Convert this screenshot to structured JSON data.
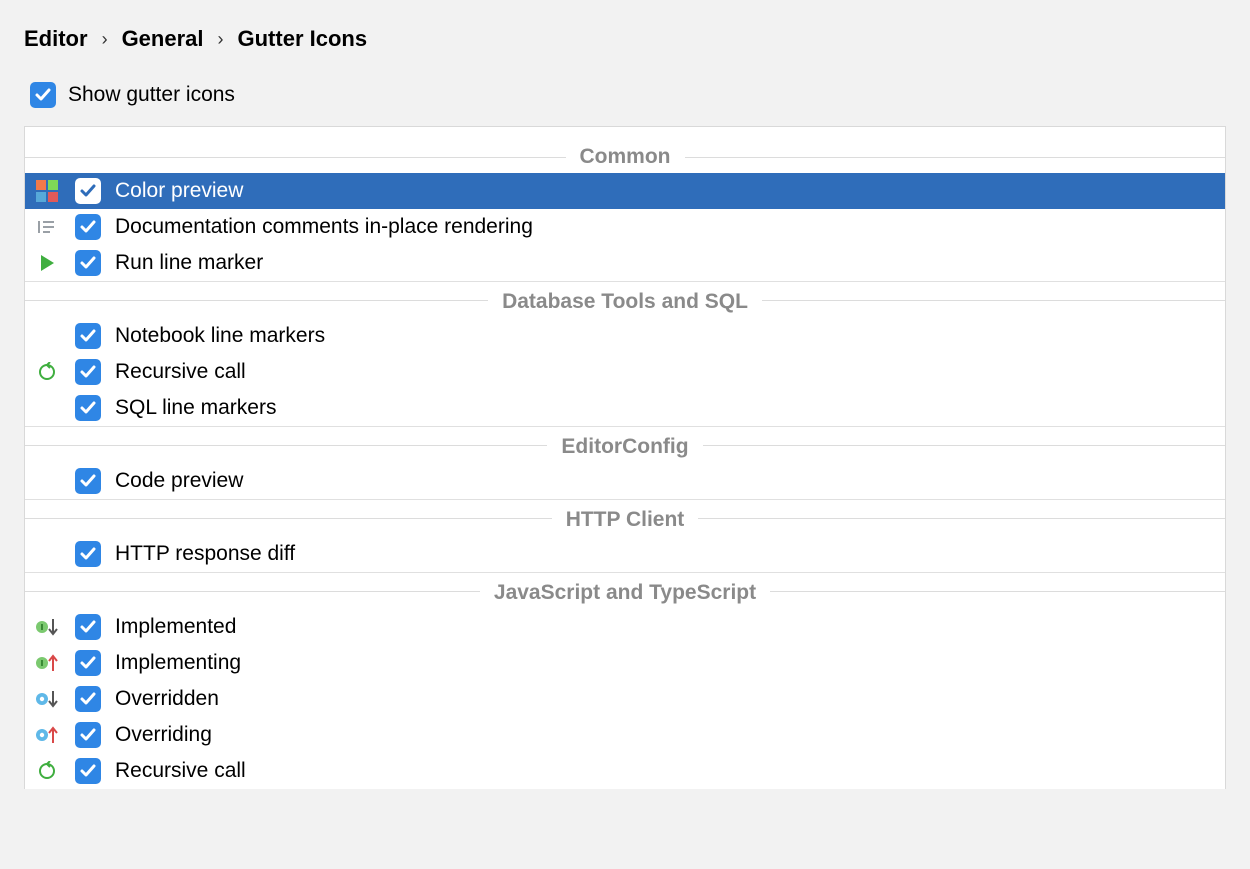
{
  "breadcrumb": {
    "items": [
      "Editor",
      "General",
      "Gutter Icons"
    ],
    "sep": "›"
  },
  "top": {
    "show_gutter_icons": {
      "label": "Show gutter icons",
      "checked": true
    }
  },
  "groups": [
    {
      "title": "Common",
      "items": [
        {
          "icon": "color-grid-icon",
          "label": "Color preview",
          "checked": true,
          "selected": true
        },
        {
          "icon": "doc-lines-icon",
          "label": "Documentation comments in-place rendering",
          "checked": true,
          "selected": false
        },
        {
          "icon": "run-triangle-icon",
          "label": "Run line marker",
          "checked": true,
          "selected": false
        }
      ]
    },
    {
      "title": "Database Tools and SQL",
      "items": [
        {
          "icon": "",
          "label": "Notebook line markers",
          "checked": true,
          "selected": false
        },
        {
          "icon": "recursive-icon",
          "label": "Recursive call",
          "checked": true,
          "selected": false
        },
        {
          "icon": "",
          "label": "SQL line markers",
          "checked": true,
          "selected": false
        }
      ]
    },
    {
      "title": "EditorConfig",
      "items": [
        {
          "icon": "",
          "label": "Code preview",
          "checked": true,
          "selected": false
        }
      ]
    },
    {
      "title": "HTTP Client",
      "items": [
        {
          "icon": "",
          "label": "HTTP response diff",
          "checked": true,
          "selected": false
        }
      ]
    },
    {
      "title": "JavaScript and TypeScript",
      "items": [
        {
          "icon": "implemented-icon",
          "label": "Implemented",
          "checked": true,
          "selected": false
        },
        {
          "icon": "implementing-icon",
          "label": "Implementing",
          "checked": true,
          "selected": false
        },
        {
          "icon": "overridden-icon",
          "label": "Overridden",
          "checked": true,
          "selected": false
        },
        {
          "icon": "overriding-icon",
          "label": "Overriding",
          "checked": true,
          "selected": false
        },
        {
          "icon": "recursive-icon",
          "label": "Recursive call",
          "checked": true,
          "selected": false
        }
      ]
    }
  ]
}
